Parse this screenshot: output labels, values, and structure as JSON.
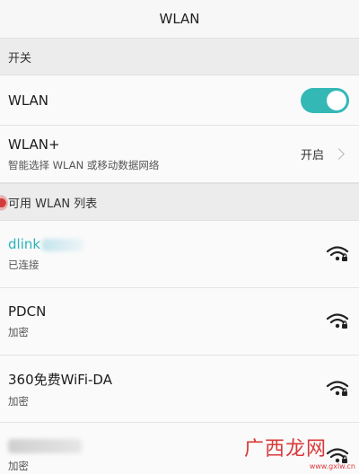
{
  "header": {
    "title": "WLAN"
  },
  "sections": {
    "switch_header": "开关",
    "available_header": "可用 WLAN 列表"
  },
  "wlan_row": {
    "label": "WLAN",
    "toggle_on": true
  },
  "wlan_plus_row": {
    "label": "WLAN+",
    "subtitle": "智能选择 WLAN 或移动数据网络",
    "status": "开启"
  },
  "networks": [
    {
      "name": "dlink",
      "status": "已连接",
      "connected": true
    },
    {
      "name": "PDCN",
      "status": "加密"
    },
    {
      "name": "360免费WiFi-DA",
      "status": "加密"
    },
    {
      "name": "",
      "status": "加密"
    }
  ],
  "watermark": {
    "text": "广西龙网",
    "url": "www.gxlw.cn"
  },
  "colors": {
    "accent": "#34b8b6",
    "connected_text": "#2bb3b9",
    "watermark": "#d9393b"
  }
}
